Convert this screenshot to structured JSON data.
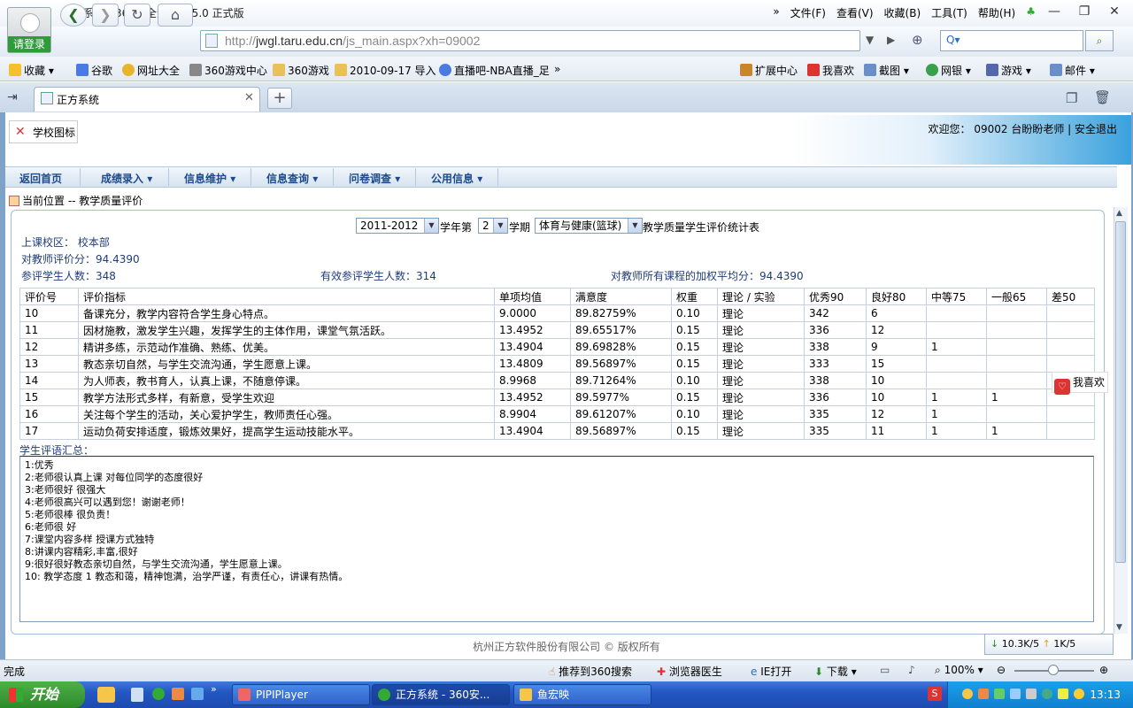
{
  "browser": {
    "title": "正方系统 - 360安全浏览器 5.0 正式版",
    "login_label": "请登录",
    "menu": [
      "文件(F)",
      "查看(V)",
      "收藏(B)",
      "工具(T)",
      "帮助(H)"
    ],
    "url_host": "jwgl.taru.edu.cn",
    "url_prefix": "http://",
    "url_path": "/js_main.aspx?xh=09002",
    "favorites": [
      "收藏",
      "谷歌",
      "网址大全",
      "360游戏中心",
      "360游戏",
      "2010-09-17 导入",
      "直播吧-NBA直播_足"
    ],
    "favorites_more": "»",
    "right_tools": [
      "扩展中心",
      "我喜欢",
      "截图",
      "网银",
      "游戏",
      "邮件"
    ],
    "tab_label": "正方系统",
    "status": "完成",
    "status_items": [
      "推荐到360搜索",
      "浏览器医生",
      "IE打开",
      "下载",
      "100%"
    ],
    "speed_down": "10.3K/5",
    "speed_up": "1K/5"
  },
  "page": {
    "logo_alt": "学校图标",
    "welcome": "欢迎您：  09002 台盼盼老师 | 安全退出",
    "nav": [
      "返回首页",
      "成绩录入",
      "信息维护",
      "信息查询",
      "问卷调查",
      "公用信息"
    ],
    "breadcrumb": "当前位置 -- 教学质量评价",
    "filters": {
      "year": "2011-2012",
      "year_suffix": "学年第",
      "term": "2",
      "term_suffix": "学期",
      "course": "体育与健康(篮球)",
      "course_suffix": "教学质量学生评价统计表"
    },
    "campus_label": "上课校区：",
    "campus": "校本部",
    "teacher_score_label": "对教师评价分：",
    "teacher_score": "94.4390",
    "participants_label": "参评学生人数：",
    "participants": "348",
    "valid_label": "有效参评学生人数：",
    "valid": "314",
    "weighted_label": "对教师所有课程的加权平均分：",
    "weighted": "94.4390",
    "table": {
      "headers": [
        "评价号",
        "评价指标",
        "单项均值",
        "满意度",
        "权重",
        "理论 / 实验",
        "优秀90",
        "良好80",
        "中等75",
        "一般65",
        "差50"
      ],
      "rows": [
        [
          "10",
          "备课充分，教学内容符合学生身心特点。",
          "9.0000",
          "89.82759%",
          "0.10",
          "理论",
          "342",
          "6",
          "",
          "",
          ""
        ],
        [
          "11",
          "因材施教，激发学生兴趣，发挥学生的主体作用，课堂气氛活跃。",
          "13.4952",
          "89.65517%",
          "0.15",
          "理论",
          "336",
          "12",
          "",
          "",
          ""
        ],
        [
          "12",
          "精讲多练，示范动作准确、熟练、优美。",
          "13.4904",
          "89.69828%",
          "0.15",
          "理论",
          "338",
          "9",
          "1",
          "",
          ""
        ],
        [
          "13",
          "教态亲切自然，与学生交流沟通，学生愿意上课。",
          "13.4809",
          "89.56897%",
          "0.15",
          "理论",
          "333",
          "15",
          "",
          "",
          ""
        ],
        [
          "14",
          "为人师表，教书育人，认真上课，不随意停课。",
          "8.9968",
          "89.71264%",
          "0.10",
          "理论",
          "338",
          "10",
          "",
          "",
          ""
        ],
        [
          "15",
          "教学方法形式多样，有新意，受学生欢迎",
          "13.4952",
          "89.5977%",
          "0.15",
          "理论",
          "336",
          "10",
          "1",
          "1",
          ""
        ],
        [
          "16",
          "关注每个学生的活动，关心爱护学生，教师责任心强。",
          "8.9904",
          "89.61207%",
          "0.10",
          "理论",
          "335",
          "12",
          "1",
          "",
          ""
        ],
        [
          "17",
          "运动负荷安排适度，锻炼效果好，提高学生运动技能水平。",
          "13.4904",
          "89.56897%",
          "0.15",
          "理论",
          "335",
          "11",
          "1",
          "1",
          ""
        ]
      ]
    },
    "comments_label": "学生评语汇总：",
    "comments": [
      "1:优秀",
      "2:老师很认真上课 对每位同学的态度很好",
      "3:老师很好 很强大",
      "4:老师很高兴可以遇到您！谢谢老师！",
      "5:老师很棒 很负责！",
      "6:老师很 好",
      "7:课堂内容多样 授课方式独特",
      "8:讲课内容精彩,丰富,很好",
      "9:很好很好教态亲切自然，与学生交流沟通，学生愿意上课。",
      "10: 教学态度 1 教态和蔼，精神饱满，治学严谨，有责任心，讲课有热情。"
    ],
    "footer": "杭州正方软件股份有限公司 © 版权所有",
    "like_label": "我喜欢"
  },
  "taskbar": {
    "start": "开始",
    "tasks": [
      "PIPIPlayer",
      "正方系统 - 360安...",
      "鱼宏映"
    ],
    "clock": "13:13"
  }
}
